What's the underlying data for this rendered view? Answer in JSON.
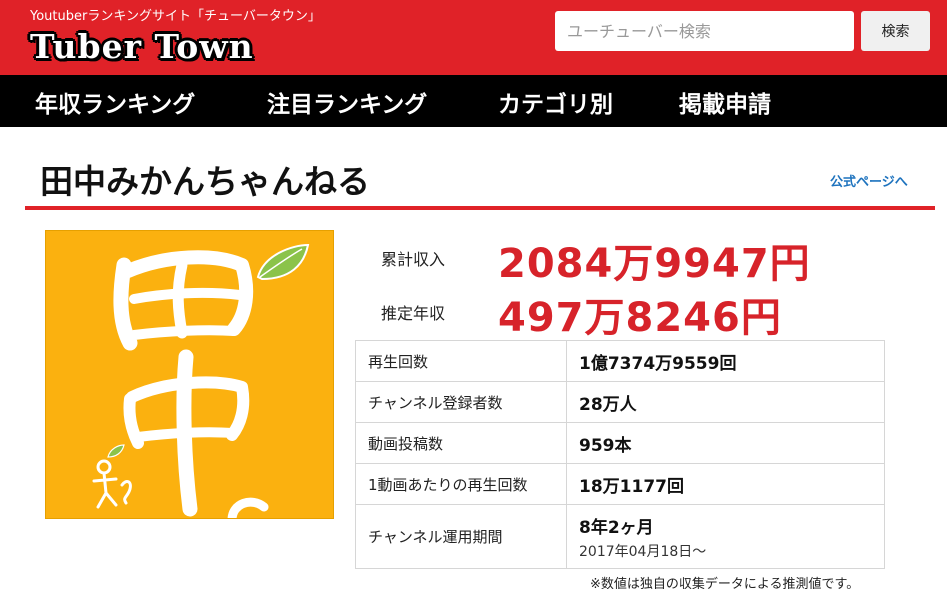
{
  "header": {
    "tagline": "Youtuberランキングサイト「チューバータウン」",
    "logo": "Tuber Town",
    "search_placeholder": "ユーチューバー検索",
    "search_button": "検索",
    "bg_color": "#e02228"
  },
  "nav": {
    "items": [
      "年収ランキング",
      "注目ランキング",
      "カテゴリ別",
      "掲載申請"
    ]
  },
  "channel": {
    "name": "田中みかんちゃんねる",
    "official_link": "公式ページへ",
    "thumbnail_bg": "#fbb10f"
  },
  "earnings": {
    "total_label": "累計収入",
    "total_value": "2084万9947円",
    "annual_label": "推定年収",
    "annual_value": "497万8246円",
    "accent_color": "#d7232a"
  },
  "stats": [
    {
      "label": "再生回数",
      "value": "1億7374万9559回"
    },
    {
      "label": "チャンネル登録者数",
      "value": "28万人"
    },
    {
      "label": "動画投稿数",
      "value": "959本"
    },
    {
      "label": "1動画あたりの再生回数",
      "value": "18万1177回"
    },
    {
      "label": "チャンネル運用期間",
      "value": "8年2ヶ月",
      "sub": "2017年04月18日〜"
    }
  ],
  "note": "※数値は独自の収集データによる推測値です。"
}
